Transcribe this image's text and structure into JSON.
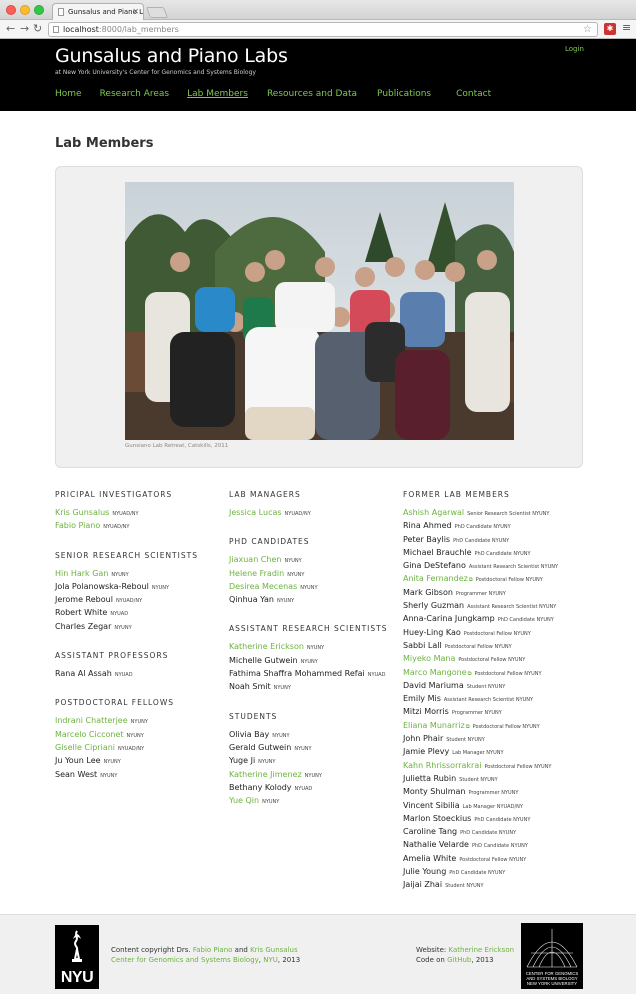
{
  "browser": {
    "tab_title": "Gunsalus and Piano Labs —",
    "url_host": "localhost",
    "url_path": ":8000/lab_members"
  },
  "header": {
    "title": "Gunsalus and Piano Labs",
    "subtitle": "at New York University's Center for Genomics and Systems Biology",
    "login": "Login",
    "nav": [
      "Home",
      "Research Areas",
      "Lab Members",
      "Resources and Data",
      "Publications",
      "Contact"
    ],
    "active_nav": "Lab Members"
  },
  "page_title": "Lab Members",
  "photo_caption": "Gunsiano Lab Retreat, Catskills, 2011",
  "columns": [
    [
      {
        "title": "PRICIPAL INVESTIGATORS",
        "people": [
          {
            "name": "Kris Gunsalus",
            "role": "NYUAD/NY",
            "link": true
          },
          {
            "name": "Fabio Piano",
            "role": "NYUAD/NY",
            "link": true
          }
        ]
      },
      {
        "title": "SENIOR RESEARCH SCIENTISTS",
        "people": [
          {
            "name": "Hin Hark Gan",
            "role": "NYUNY",
            "link": true
          },
          {
            "name": "Jola Polanowska-Reboul",
            "role": "NYUNY",
            "link": false
          },
          {
            "name": "Jerome Reboul",
            "role": "NYUAD/NY",
            "link": false
          },
          {
            "name": "Robert White",
            "role": "NYUAD",
            "link": false
          },
          {
            "name": "Charles Zegar",
            "role": "NYUNY",
            "link": false
          }
        ]
      },
      {
        "title": "ASSISTANT PROFESSORS",
        "people": [
          {
            "name": "Rana Al Assah",
            "role": "NYUAD",
            "link": false
          }
        ]
      },
      {
        "title": "POSTDOCTORAL FELLOWS",
        "people": [
          {
            "name": "Indrani Chatterjee",
            "role": "NYUNY",
            "link": true
          },
          {
            "name": "Marcelo Cicconet",
            "role": "NYUNY",
            "link": true
          },
          {
            "name": "Giselle Cipriani",
            "role": "NYUAD/NY",
            "link": true
          },
          {
            "name": "Ju Youn Lee",
            "role": "NYUNY",
            "link": false
          },
          {
            "name": "Sean West",
            "role": "NYUNY",
            "link": false
          }
        ]
      }
    ],
    [
      {
        "title": "LAB MANAGERS",
        "people": [
          {
            "name": "Jessica Lucas",
            "role": "NYUAD/NY",
            "link": true
          }
        ]
      },
      {
        "title": "PHD CANDIDATES",
        "people": [
          {
            "name": "Jiaxuan Chen",
            "role": "NYUNY",
            "link": true
          },
          {
            "name": "Helene Fradin",
            "role": "NYUNY",
            "link": true
          },
          {
            "name": "Desirea Mecenas",
            "role": "NYUNY",
            "link": true
          },
          {
            "name": "Qinhua Yan",
            "role": "NYUNY",
            "link": false
          }
        ]
      },
      {
        "title": "ASSISTANT RESEARCH SCIENTISTS",
        "people": [
          {
            "name": "Katherine Erickson",
            "role": "NYUNY",
            "link": true
          },
          {
            "name": "Michelle Gutwein",
            "role": "NYUNY",
            "link": false
          },
          {
            "name": "Fathima Shaffra Mohammed Refai",
            "role": "NYUAD",
            "link": false
          },
          {
            "name": "Noah Smit",
            "role": "NYUNY",
            "link": false
          }
        ]
      },
      {
        "title": "STUDENTS",
        "people": [
          {
            "name": "Olivia Bay",
            "role": "NYUNY",
            "link": false
          },
          {
            "name": "Gerald Gutwein",
            "role": "NYUNY",
            "link": false
          },
          {
            "name": "Yuge Ji",
            "role": "NYUNY",
            "link": false
          },
          {
            "name": "Katherine Jimenez",
            "role": "NYUNY",
            "link": true
          },
          {
            "name": "Bethany Kolody",
            "role": "NYUAD",
            "link": false
          },
          {
            "name": "Yue Qin",
            "role": "NYUNY",
            "link": true
          }
        ]
      }
    ],
    [
      {
        "title": "FORMER LAB MEMBERS",
        "people": [
          {
            "name": "Ashish Agarwal",
            "role": "Senior Research Scientist   NYUNY",
            "link": true
          },
          {
            "name": "Rina Ahmed",
            "role": "PhD Candidate   NYUNY",
            "link": false
          },
          {
            "name": "Peter Baylis",
            "role": "PhD Candidate   NYUNY",
            "link": false
          },
          {
            "name": "Michael Brauchle",
            "role": "PhD Candidate   NYUNY",
            "link": false
          },
          {
            "name": "Gina DeStefano",
            "role": "Assistant Research Scientist   NYUNY",
            "link": false
          },
          {
            "name": "Anita Fernandez",
            "role": "Postdoctoral Fellow   NYUNY",
            "link": true,
            "ext": true
          },
          {
            "name": "Mark Gibson",
            "role": "Programmer   NYUNY",
            "link": false
          },
          {
            "name": "Sherly Guzman",
            "role": "Assistant Research Scientist   NYUNY",
            "link": false
          },
          {
            "name": "Anna-Carina Jungkamp",
            "role": "PhD Candidate   NYUNY",
            "link": false
          },
          {
            "name": "Huey-Ling Kao",
            "role": "Postdoctoral Fellow   NYUNY",
            "link": false
          },
          {
            "name": "Sabbi Lall",
            "role": "Postdoctoral Fellow   NYUNY",
            "link": false
          },
          {
            "name": "Miyeko Mana",
            "role": "Postdoctoral Fellow   NYUNY",
            "link": true
          },
          {
            "name": "Marco Mangone",
            "role": "Postdoctoral Fellow   NYUNY",
            "link": true,
            "ext": true
          },
          {
            "name": "David Mariuma",
            "role": "Student   NYUNY",
            "link": false
          },
          {
            "name": "Emily Mis",
            "role": "Assistant Research Scientist   NYUNY",
            "link": false
          },
          {
            "name": "Mitzi Morris",
            "role": "Programmer   NYUNY",
            "link": false
          },
          {
            "name": "Eliana Munarriz",
            "role": "Postdoctoral Fellow   NYUNY",
            "link": true,
            "ext": true
          },
          {
            "name": "John Phair",
            "role": "Student   NYUNY",
            "link": false
          },
          {
            "name": "Jamie Plevy",
            "role": "Lab Manager   NYUNY",
            "link": false
          },
          {
            "name": "Kahn Rhrissorrakrai",
            "role": "Postdoctoral Fellow   NYUNY",
            "link": true
          },
          {
            "name": "Julietta Rubin",
            "role": "Student   NYUNY",
            "link": false
          },
          {
            "name": "Monty Shulman",
            "role": "Programmer   NYUNY",
            "link": false
          },
          {
            "name": "Vincent Sibilia",
            "role": "Lab Manager   NYUAD/NY",
            "link": false
          },
          {
            "name": "Marlon Stoeckius",
            "role": "PhD Candidate   NYUNY",
            "link": false
          },
          {
            "name": "Caroline Tang",
            "role": "PhD Candidate   NYUNY",
            "link": false
          },
          {
            "name": "Nathalie Velarde",
            "role": "PhD Candidate   NYUNY",
            "link": false
          },
          {
            "name": "Amelia White",
            "role": "Postdoctoral Fellow   NYUNY",
            "link": false
          },
          {
            "name": "Julie Young",
            "role": "PhD Candidate   NYUNY",
            "link": false
          },
          {
            "name": "Jaijai Zhai",
            "role": "Student   NYUNY",
            "link": false
          }
        ]
      }
    ]
  ],
  "footer": {
    "copyright_prefix": "Content copyright Drs.",
    "fabio": "Fabio Piano",
    "and": "and",
    "kris": "Kris Gunsalus",
    "cgsb": "Center for Genomics and Systems Biology",
    "nyu": "NYU",
    "year": ", 2013",
    "website_label": "Website:",
    "website_author": "Katherine Erickson",
    "code_on": "Code on",
    "github": "GitHub",
    "code_year": ", 2013",
    "nyu_logo_text": "NYU",
    "cgsb_logo_text": "CENTER FOR GENOMICS AND SYSTEMS BIOLOGY NEW YORK UNIVERSITY"
  },
  "colors": {
    "accent_green": "#6cb33f",
    "header_bg": "#000000",
    "panel_bg": "#f0f0f0"
  }
}
